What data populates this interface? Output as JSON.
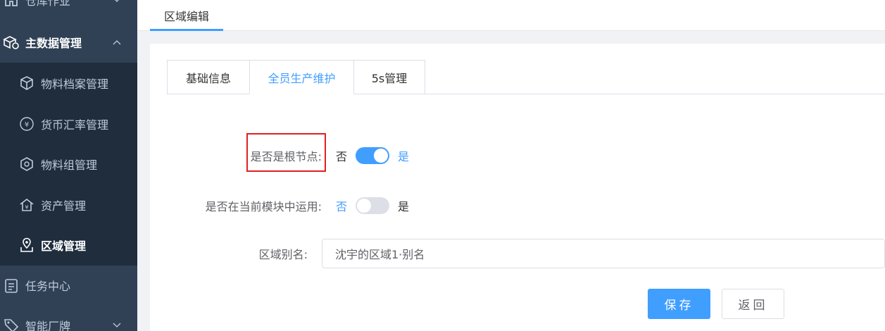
{
  "sidebar": {
    "items": [
      {
        "label": "仓库作业",
        "icon": "warehouse-icon",
        "level": "top"
      },
      {
        "label": "主数据管理",
        "icon": "master-data-icon",
        "level": "top",
        "expanded": true
      },
      {
        "label": "物料档案管理",
        "icon": "cube-icon",
        "level": "sub"
      },
      {
        "label": "货币汇率管理",
        "icon": "yen-circle-icon",
        "level": "sub"
      },
      {
        "label": "物料组管理",
        "icon": "hexagon-box-icon",
        "level": "sub"
      },
      {
        "label": "资产管理",
        "icon": "house-asset-icon",
        "level": "sub"
      },
      {
        "label": "区域管理",
        "icon": "map-pin-icon",
        "level": "sub",
        "active": true
      },
      {
        "label": "任务中心",
        "icon": "clipboard-list-icon",
        "level": "top"
      },
      {
        "label": "智能厂牌",
        "icon": "tag-icon",
        "level": "top"
      }
    ]
  },
  "topbar": {
    "tab_label": "区域编辑"
  },
  "tabs": [
    {
      "label": "基础信息",
      "active": false
    },
    {
      "label": "全员生产维护",
      "active": true
    },
    {
      "label": "5s管理",
      "active": false
    }
  ],
  "form": {
    "root_node": {
      "label": "是否是根节点:",
      "off_text": "否",
      "on_text": "是",
      "value": true
    },
    "current_module": {
      "label": "是否在当前模块中运用:",
      "off_text": "否",
      "on_text": "是",
      "value": false
    },
    "alias": {
      "label": "区域别名:",
      "value": "沈宇的区域1·别名"
    }
  },
  "actions": {
    "save_label": "保存",
    "back_label": "返回"
  },
  "colors": {
    "sidebar_bg": "#304156",
    "accent": "#409eff",
    "highlight": "#e02020"
  }
}
